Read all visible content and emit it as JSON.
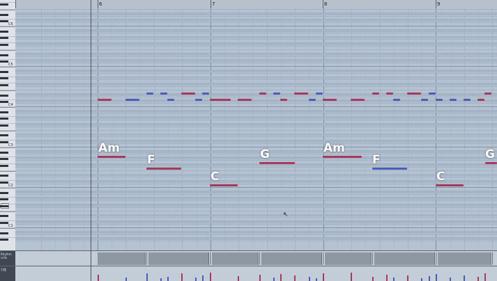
{
  "ruler": {
    "bars": [
      "6",
      "7",
      "8",
      "9"
    ]
  },
  "keyboard": {
    "octaves": [
      "C6",
      "C5",
      "C4",
      "C3",
      "C2",
      "C1"
    ]
  },
  "chords": {
    "am1": "Am",
    "f1": "F",
    "c1": "C",
    "g1": "G",
    "am2": "Am",
    "f2": "F",
    "c2": "C",
    "g2": "G"
  },
  "lanes": {
    "chord_track_label": "Rhythm\ncells",
    "velocity_label": "力度"
  },
  "colors": {
    "note_red": "#a53a5e",
    "note_blue": "#4a5db8",
    "grid_bg": "#b4c2d2"
  },
  "icons": {
    "cursor": "mouse-pointer-icon"
  }
}
